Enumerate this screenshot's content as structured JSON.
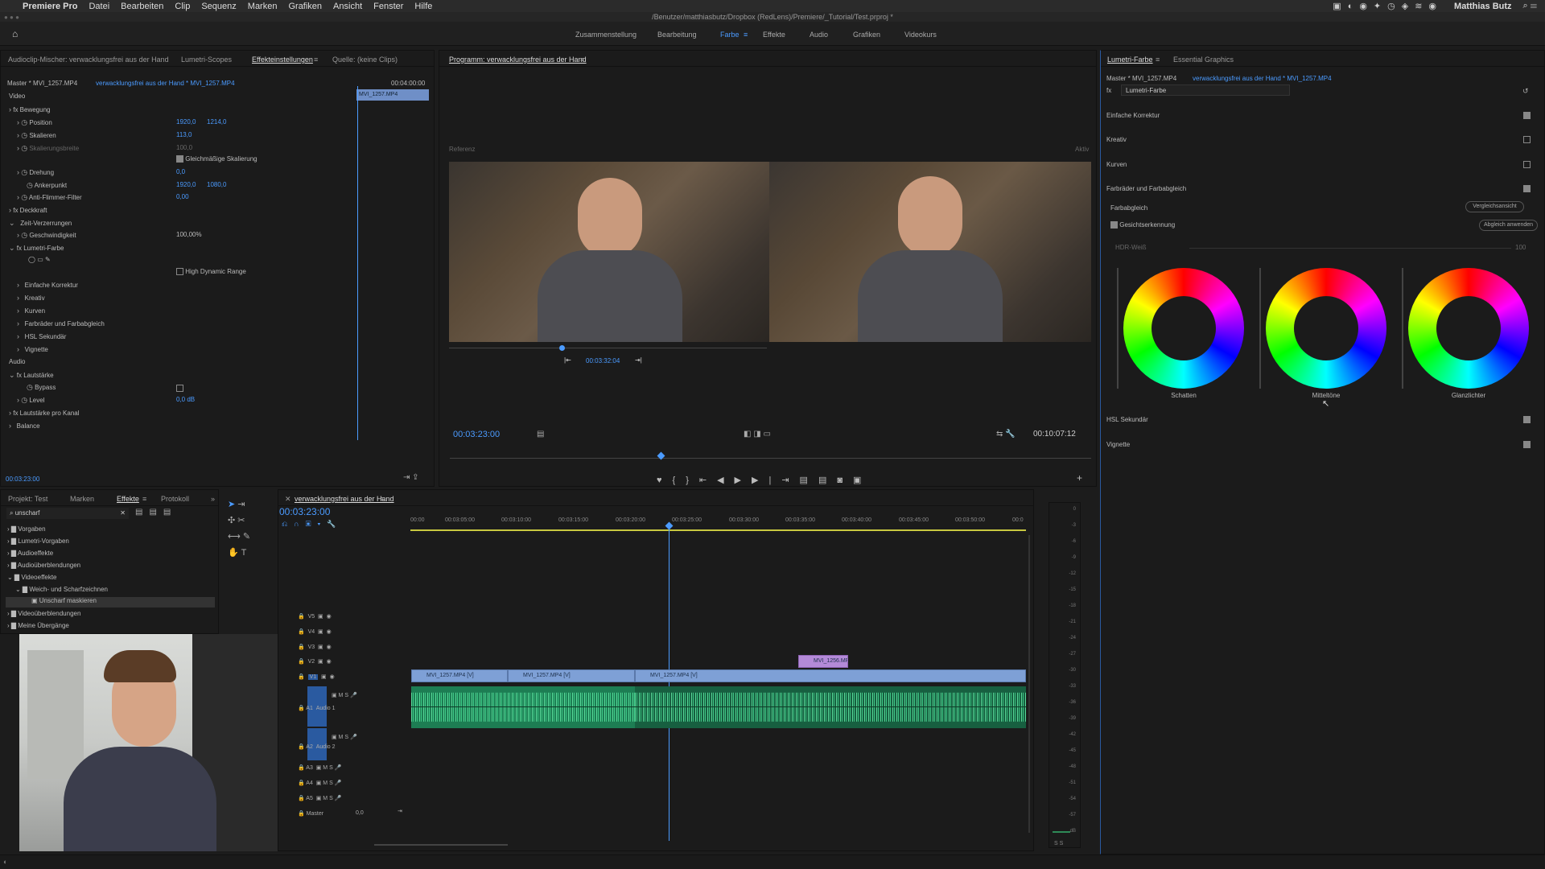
{
  "menubar": {
    "apple": "",
    "app": "Premiere Pro",
    "items": [
      "Datei",
      "Bearbeiten",
      "Clip",
      "Sequenz",
      "Marken",
      "Grafiken",
      "Ansicht",
      "Fenster",
      "Hilfe"
    ],
    "user": "Matthias Butz"
  },
  "title": "/Benutzer/matthiasbutz/Dropbox (RedLens)/Premiere/_Tutorial/Test.prproj *",
  "workspaces": [
    "Zusammenstellung",
    "Bearbeitung",
    "Farbe",
    "Effekte",
    "Audio",
    "Grafiken",
    "Videokurs"
  ],
  "active_workspace": "Farbe",
  "effects_panel": {
    "tabs": [
      "Audioclip-Mischer: verwacklungsfrei aus der Hand",
      "Lumetri-Scopes",
      "Effekteinstellungen",
      "Quelle: (keine Clips)"
    ],
    "master": "Master * MVI_1257.MP4",
    "clip": "verwacklungsfrei aus der Hand * MVI_1257.MP4",
    "timecode_top": "00:04:00:00",
    "mini_clip": "MVI_1257.MP4",
    "video_label": "Video",
    "rows": {
      "bewegung": "Bewegung",
      "position": "Position",
      "position_x": "1920,0",
      "position_y": "1214,0",
      "skalieren": "Skalieren",
      "skalieren_val": "113,0",
      "skalierungsbreite": "Skalierungsbreite",
      "skalierungsbreite_val": "100,0",
      "gleichmaessig": "Gleichmäßige Skalierung",
      "drehung": "Drehung",
      "drehung_val": "0,0",
      "ankerpunkt": "Ankerpunkt",
      "anker_x": "1920,0",
      "anker_y": "1080,0",
      "antiflimmer": "Anti-Flimmer-Filter",
      "antiflimmer_val": "0,00",
      "deckkraft": "Deckkraft",
      "zeitverzerrung": "Zeit-Verzerrungen",
      "geschwindigkeit": "Geschwindigkeit",
      "geschwindigkeit_val": "100,00%",
      "lumetri": "Lumetri-Farbe",
      "hdr": "High Dynamic Range",
      "einfache": "Einfache Korrektur",
      "kreativ": "Kreativ",
      "kurven": "Kurven",
      "farbraeder": "Farbräder und Farbabgleich",
      "hsl": "HSL Sekundär",
      "vignette": "Vignette",
      "audio_label": "Audio",
      "lautstaerke": "Lautstärke",
      "bypass": "Bypass",
      "level": "Level",
      "level_val": "0,0 dB",
      "lautstaerke_kanal": "Lautstärke pro Kanal",
      "balance": "Balance"
    },
    "timecode_bottom": "00:03:23:00"
  },
  "program": {
    "title": "Programm: verwacklungsfrei aus der Hand",
    "referenz": "Referenz",
    "aktiv": "Aktiv",
    "ref_timecode": "00:03:32:04",
    "timecode": "00:03:23:00",
    "duration": "00:10:07:12"
  },
  "lumetri": {
    "tabs": [
      "Lumetri-Farbe",
      "Essential Graphics"
    ],
    "master": "Master * MVI_1257.MP4",
    "clip": "verwacklungsfrei aus der Hand * MVI_1257.MP4",
    "fx": "Lumetri-Farbe",
    "sections": [
      "Einfache Korrektur",
      "Kreativ",
      "Kurven",
      "Farbräder und Farbabgleich"
    ],
    "farbabgleich": "Farbabgleich",
    "vergleich_btn": "Vergleichsansicht",
    "gesicht": "Gesichtserkennung",
    "abgleich_btn": "Abgleich anwenden",
    "hdr_weiss": "HDR-Weiß",
    "hdr_val": "100",
    "wheels": [
      "Schatten",
      "Mitteltöne",
      "Glanzlichter"
    ],
    "hsl": "HSL Sekundär",
    "vignette": "Vignette"
  },
  "project_panel": {
    "tabs": [
      "Projekt: Test",
      "Marken",
      "Effekte",
      "Protokoll"
    ],
    "search": "unscharf",
    "tree": [
      "Vorgaben",
      "Lumetri-Vorgaben",
      "Audioeffekte",
      "Audioüberblendungen",
      "Videoeffekte",
      "Weich- und Scharfzeichnen",
      "Unscharf maskieren",
      "Videoüberblendungen",
      "Meine Übergänge"
    ]
  },
  "timeline": {
    "title": "verwacklungsfrei aus der Hand",
    "timecode": "00:03:23:00",
    "ruler": [
      "00:00",
      "00:03:05:00",
      "00:03:10:00",
      "00:03:15:00",
      "00:03:20:00",
      "00:03:25:00",
      "00:03:30:00",
      "00:03:35:00",
      "00:03:40:00",
      "00:03:45:00",
      "00:03:50:00",
      "00:0"
    ],
    "tracks_v": [
      "V5",
      "V4",
      "V3",
      "V2",
      "V1"
    ],
    "tracks_a": [
      "A1",
      "A2",
      "A3",
      "A4",
      "A5"
    ],
    "audio1": "Audio 1",
    "audio2": "Audio 2",
    "master": "Master",
    "master_val": "0,0",
    "clips": [
      "MVI_1257.MP4 [V]",
      "MVI_1257.MP4 [V]",
      "MVI_1257.MP4 [V]",
      "MVI_1256.MP4"
    ]
  },
  "meter": [
    "0",
    "-3",
    "-6",
    "-9",
    "-12",
    "-15",
    "-18",
    "-21",
    "-24",
    "-27",
    "-30",
    "-33",
    "-36",
    "-39",
    "-42",
    "-45",
    "-48",
    "-51",
    "-54",
    "-57",
    "dB"
  ],
  "meter_bottom": "S  S"
}
